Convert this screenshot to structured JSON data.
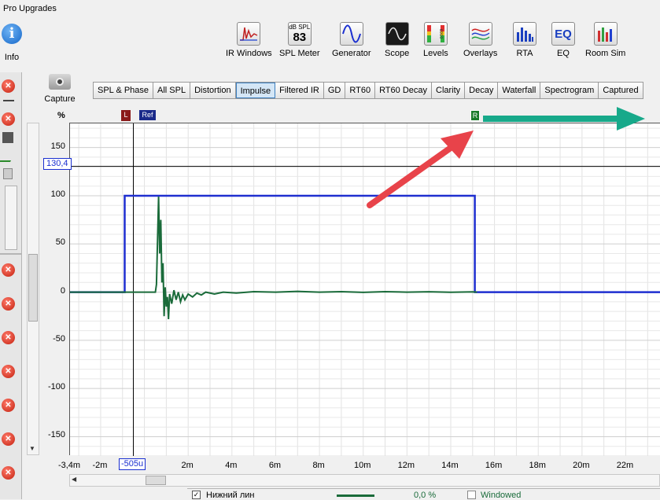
{
  "menu": {
    "pro_upgrades": "Pro Upgrades"
  },
  "toolbar": {
    "info": "Info",
    "ir_windows": "IR Windows",
    "spl_meter": "SPL Meter",
    "spl_meter_unit": "dB SPL",
    "spl_meter_value": "83",
    "generator": "Generator",
    "scope": "Scope",
    "levels": "Levels",
    "overlays": "Overlays",
    "rta": "RTA",
    "eq": "EQ",
    "eq_icon_text": "EQ",
    "room_sim": "Room Sim",
    "capture": "Capture"
  },
  "tabs": [
    "SPL & Phase",
    "All SPL",
    "Distortion",
    "Impulse",
    "Filtered IR",
    "GD",
    "RT60",
    "RT60 Decay",
    "Clarity",
    "Decay",
    "Waterfall",
    "Spectrogram",
    "Captured"
  ],
  "active_tab": "Impulse",
  "plot": {
    "y_unit": "%",
    "cursor_y_value": "130,4",
    "cursor_x_value": "-505u",
    "marker_l": "L",
    "marker_ref": "Ref",
    "marker_r": "R",
    "y_ticks": [
      "150",
      "100",
      "50",
      "0",
      "-50",
      "-100",
      "-150"
    ],
    "x_ticks": [
      "-3,4m",
      "-2m",
      "2m",
      "4m",
      "6m",
      "8m",
      "10m",
      "12m",
      "14m",
      "16m",
      "18m",
      "20m",
      "22m"
    ]
  },
  "legend": {
    "measurement_name": "Нижний лин",
    "percent": "0,0 %",
    "windowed_label": "Windowed"
  },
  "colors": {
    "window_line": "#1f2fd0",
    "impulse_line": "#1a6b3a",
    "red_arrow": "#e8434a",
    "teal_arrow": "#17a98a"
  },
  "chart_data": {
    "type": "line",
    "title": "",
    "xlabel": "",
    "ylabel": "%",
    "xlim": [
      -3.4,
      23.6
    ],
    "ylim": [
      -170,
      175
    ],
    "x_tick_values": [
      -3.4,
      -2,
      2,
      4,
      6,
      8,
      10,
      12,
      14,
      16,
      18,
      20,
      22
    ],
    "y_tick_values": [
      150,
      100,
      50,
      0,
      -50,
      -100,
      -150
    ],
    "grid": true,
    "series": [
      {
        "role": "window",
        "values": [
          [
            -3.4,
            0
          ],
          [
            -0.9,
            0
          ],
          [
            -0.9,
            100
          ],
          [
            15.1,
            100
          ],
          [
            15.1,
            0
          ],
          [
            23.6,
            0
          ]
        ]
      },
      {
        "role": "impulse",
        "values": [
          [
            -3.4,
            0
          ],
          [
            0.3,
            0
          ],
          [
            0.5,
            0
          ],
          [
            0.55,
            8
          ],
          [
            0.6,
            55
          ],
          [
            0.65,
            99
          ],
          [
            0.7,
            40
          ],
          [
            0.75,
            75
          ],
          [
            0.8,
            10
          ],
          [
            0.85,
            30
          ],
          [
            0.9,
            -25
          ],
          [
            0.95,
            5
          ],
          [
            1.0,
            -15
          ],
          [
            1.05,
            -5
          ],
          [
            1.1,
            -28
          ],
          [
            1.15,
            -2
          ],
          [
            1.25,
            -12
          ],
          [
            1.35,
            2
          ],
          [
            1.45,
            -8
          ],
          [
            1.55,
            0
          ],
          [
            1.65,
            -10
          ],
          [
            1.75,
            -3
          ],
          [
            1.85,
            -8
          ],
          [
            2.0,
            -2
          ],
          [
            2.2,
            -5
          ],
          [
            2.4,
            -1
          ],
          [
            2.6,
            -3
          ],
          [
            2.8,
            0
          ],
          [
            3.2,
            -2
          ],
          [
            3.6,
            0
          ],
          [
            4.2,
            -1
          ],
          [
            5.0,
            0.5
          ],
          [
            6.0,
            0
          ],
          [
            7.0,
            0.8
          ],
          [
            8.0,
            0
          ],
          [
            9.0,
            0.5
          ],
          [
            10.0,
            -0.3
          ],
          [
            11.0,
            0.5
          ],
          [
            12.0,
            0
          ],
          [
            13.0,
            0.4
          ],
          [
            14.0,
            -0.2
          ],
          [
            15.0,
            0.3
          ],
          [
            15.2,
            0
          ]
        ]
      }
    ]
  }
}
